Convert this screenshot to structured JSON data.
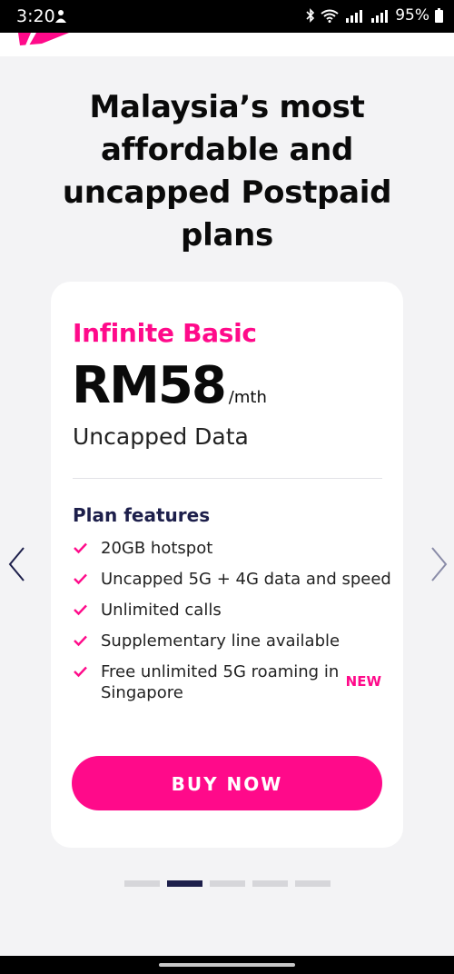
{
  "status_bar": {
    "time": "3:20",
    "battery": "95%"
  },
  "hero": {
    "headline": "Malaysia’s most affordable and uncapped Postpaid plans"
  },
  "plan_card": {
    "name": "Infinite Basic",
    "price": "RM58",
    "price_unit": "/mth",
    "data": "Uncapped Data",
    "features_title": "Plan features",
    "features": [
      {
        "text": "20GB hotspot",
        "badge": ""
      },
      {
        "text": "Uncapped 5G + 4G data and speed",
        "badge": ""
      },
      {
        "text": "Unlimited calls",
        "badge": ""
      },
      {
        "text": "Supplementary line available",
        "badge": ""
      },
      {
        "text": "Free unlimited 5G roaming in Singapore",
        "badge": "NEW"
      }
    ],
    "cta_label": "BUY NOW"
  },
  "carousel": {
    "page_count": 5,
    "active_index": 1
  },
  "colors": {
    "accent": "#ff0a8a",
    "navy": "#1d1f4b",
    "background": "#f3f3f5"
  },
  "icons": {
    "prev": "chevron-left-icon",
    "next": "chevron-right-icon",
    "feature_bullet": "check-icon"
  }
}
